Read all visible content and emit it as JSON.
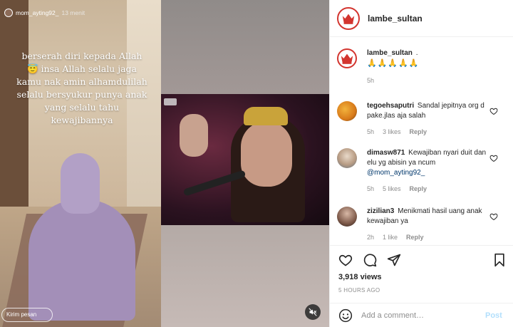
{
  "media": {
    "story": {
      "username": "mom_ayting92_",
      "time": "13 menit",
      "overlay_text": "berserah diri kepada Allah 😇 insa Allah selalu jaga kamu nak amin alhamdulilah selalu bersyukur punya anak yang selalu tahu kewajibannya",
      "message_placeholder": "Kirim pesan"
    }
  },
  "post": {
    "username": "lambe_sultan",
    "caption_user": "lambe_sultan",
    "caption_dot": ".",
    "caption_emoji": "🙏🙏🙏🙏🙏",
    "caption_time": "5h",
    "comments": [
      {
        "user": "tegoehsaputri",
        "text": "Sandal jepitnya org d pake.jlas aja salah",
        "time": "5h",
        "likes": "3 likes",
        "reply": "Reply"
      },
      {
        "user": "dimasw871",
        "text": "Kewajiban nyari duit dan elu yg abisin ya ncum",
        "mention": "@mom_ayting92_",
        "time": "5h",
        "likes": "5 likes",
        "reply": "Reply"
      },
      {
        "user": "zizilian3",
        "text": "Menikmati hasil uang anak kewajiban ya",
        "time": "2h",
        "likes": "1 like",
        "reply": "Reply"
      }
    ],
    "views": "3,918 views",
    "time_ago": "5 HOURS AGO",
    "add_comment_placeholder": "Add a comment…",
    "post_button": "Post"
  },
  "colors": {
    "brand_ring": "#d3352f",
    "link": "#00376b",
    "post_button_disabled": "#b2dffc",
    "muted_text": "#8e8e8e"
  },
  "icons": [
    "crown-logo-icon",
    "heart-icon",
    "comment-icon",
    "share-icon",
    "bookmark-icon",
    "smile-icon",
    "mute-icon"
  ]
}
